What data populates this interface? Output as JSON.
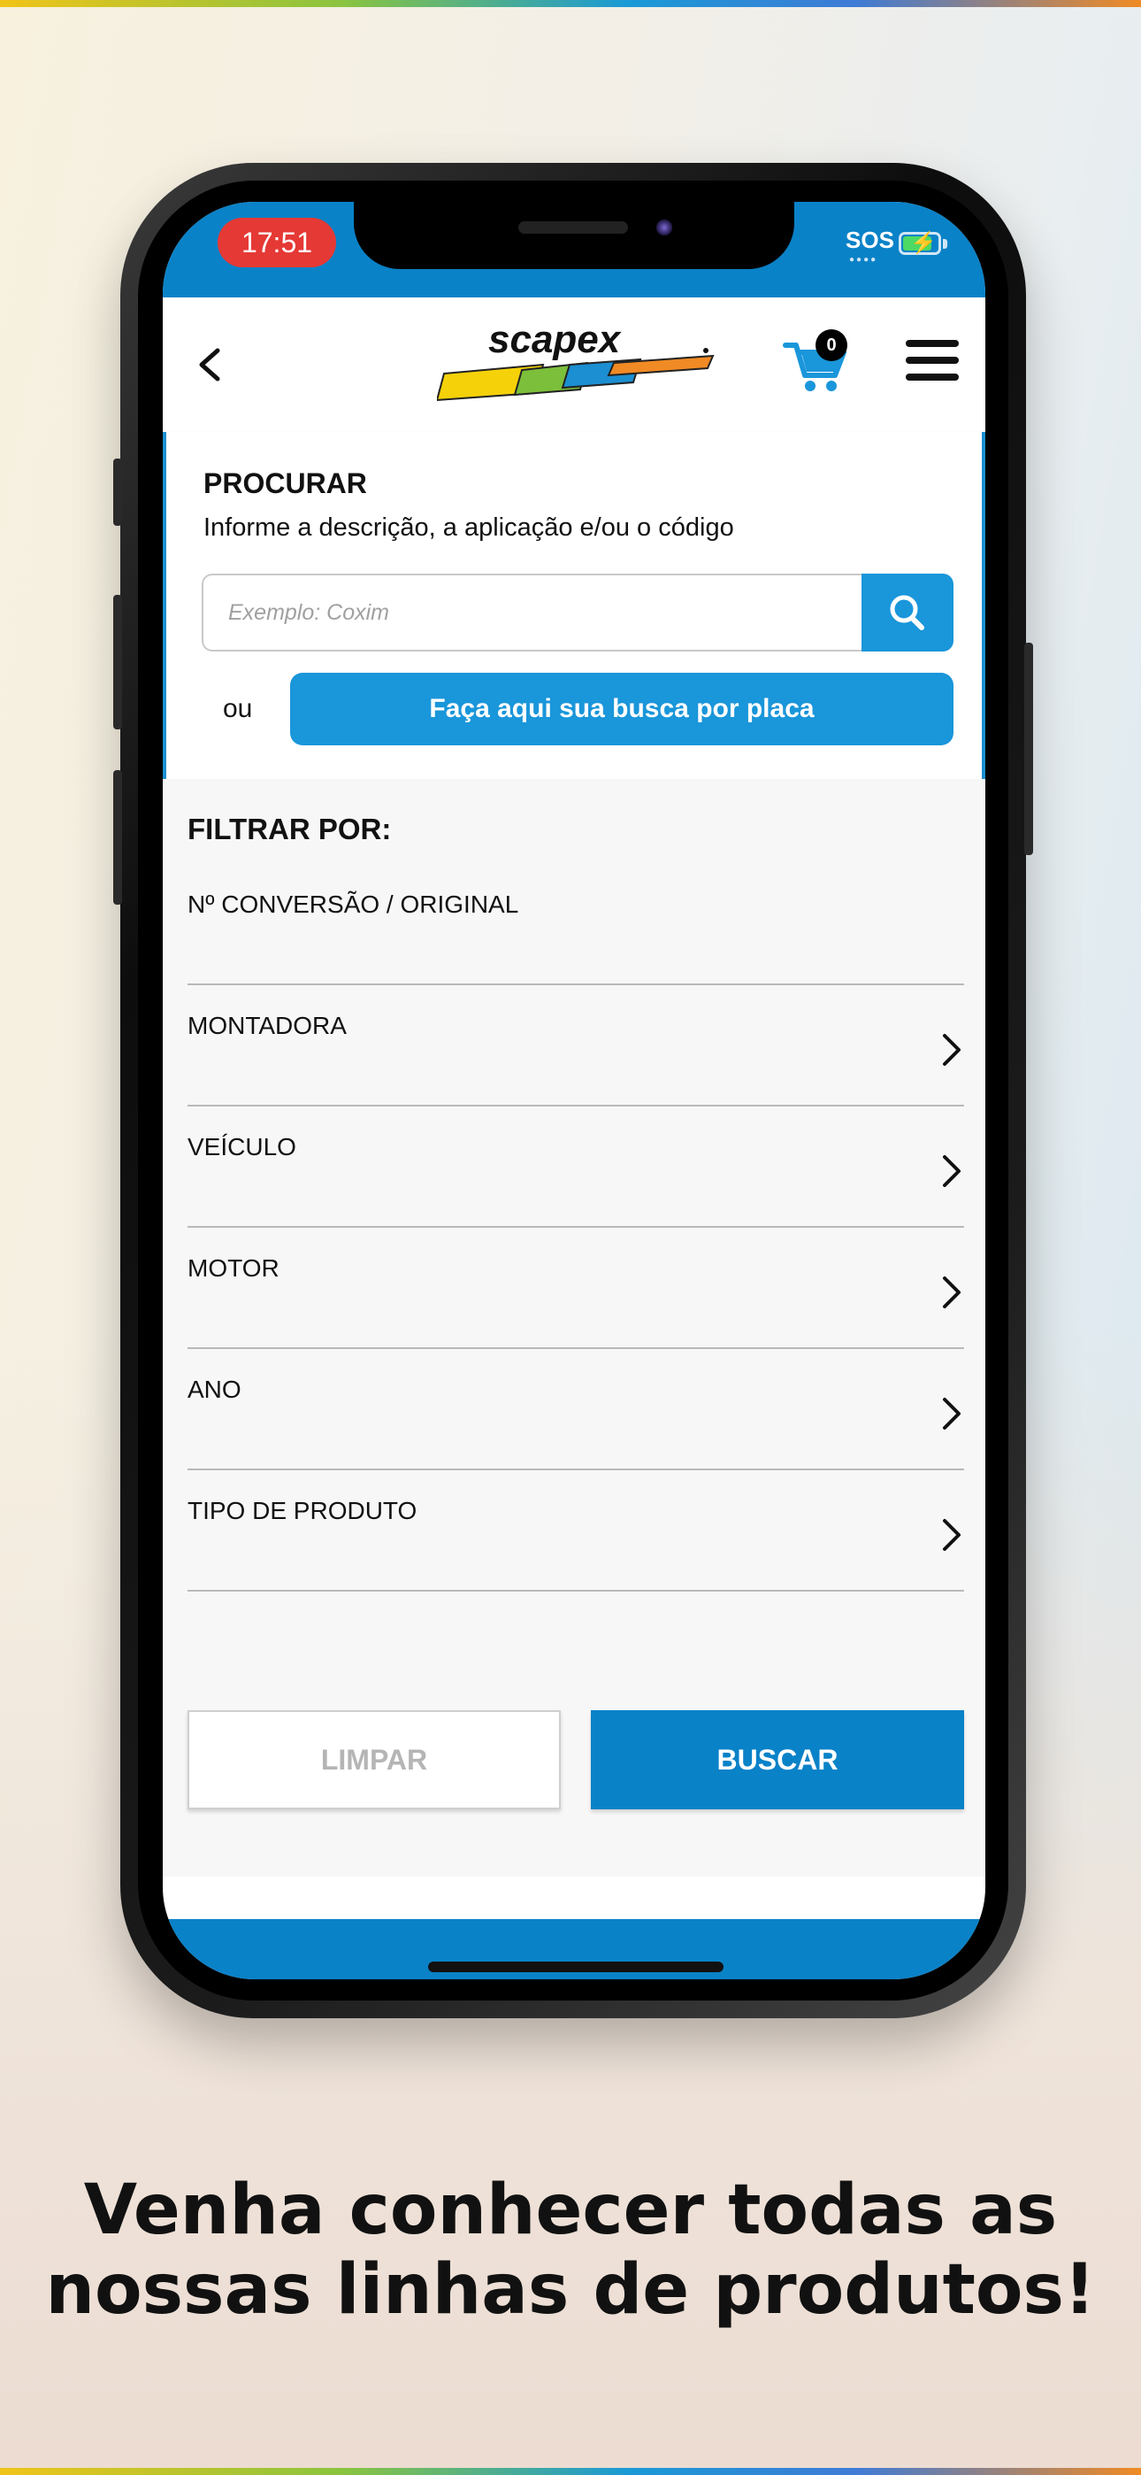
{
  "status_bar": {
    "time": "17:51",
    "carrier_status": "SOS",
    "battery_level": 0.85,
    "battery_charging": true
  },
  "app_bar": {
    "logo_text": "scapex",
    "cart_count": "0",
    "back_icon": "chevron-left-icon",
    "cart_icon": "shopping-cart-icon",
    "menu_icon": "hamburger-menu-icon"
  },
  "search": {
    "title": "PROCURAR",
    "subtitle": "Informe a descrição, a aplicação e/ou o código",
    "placeholder": "Exemplo: Coxim",
    "value": "",
    "or_label": "ou",
    "plate_button_label": "Faça aqui sua busca por placa"
  },
  "filters": {
    "title": "FILTRAR POR:",
    "items": [
      {
        "label": "Nº CONVERSÃO / ORIGINAL",
        "has_chevron": false
      },
      {
        "label": "MONTADORA",
        "has_chevron": true
      },
      {
        "label": "VEÍCULO",
        "has_chevron": true
      },
      {
        "label": "MOTOR",
        "has_chevron": true
      },
      {
        "label": "ANO",
        "has_chevron": true
      },
      {
        "label": "TIPO DE PRODUTO",
        "has_chevron": true
      }
    ]
  },
  "actions": {
    "clear_label": "LIMPAR",
    "search_label": "BUSCAR"
  },
  "tagline": {
    "line1": "Venha conhecer todas as",
    "line2": "nossas linhas de produtos!"
  },
  "colors": {
    "primary_blue": "#0a82c8",
    "accent_blue": "#1a96da",
    "time_pill_red": "#e53935"
  }
}
